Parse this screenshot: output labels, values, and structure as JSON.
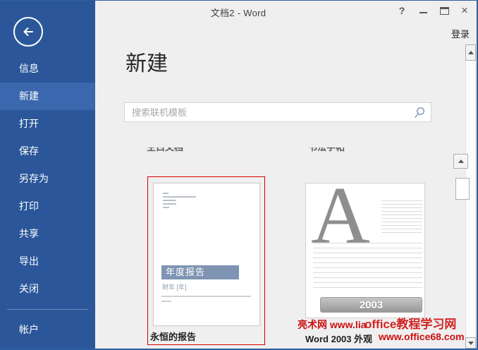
{
  "window": {
    "title": "文档2 - Word",
    "help_glyph": "?",
    "close_glyph": "×",
    "sign_in": "登录"
  },
  "sidebar": {
    "items": [
      {
        "label": "信息"
      },
      {
        "label": "新建",
        "active": true
      },
      {
        "label": "打开"
      },
      {
        "label": "保存"
      },
      {
        "label": "另存为"
      },
      {
        "label": "打印"
      },
      {
        "label": "共享"
      },
      {
        "label": "导出"
      },
      {
        "label": "关闭"
      }
    ],
    "account_label": "帐户"
  },
  "main": {
    "heading": "新建",
    "search_placeholder": "搜索联机模板",
    "partial_row_labels": [
      "空白文档",
      "书法字帖"
    ],
    "templates": [
      {
        "name": "永恒的报告",
        "selected": true,
        "preview_banner": "年度报告",
        "preview_subtitle": "财年 [年]"
      },
      {
        "name": "Word 2003 外观",
        "selected": false,
        "preview_letter": "A",
        "preview_badge": "2003"
      }
    ]
  },
  "watermarks": {
    "site_left": "亮术网 www.lia",
    "site_right": "office教程学习网",
    "site_url": "www.office68.com"
  },
  "colors": {
    "sidebar_blue": "#2b579a",
    "sidebar_active_blue": "#3a67ae",
    "selection_red": "#d40000",
    "banner_blue": "#7e94b2",
    "watermark_red": "#cc1111",
    "background_gray": "#efefef"
  }
}
